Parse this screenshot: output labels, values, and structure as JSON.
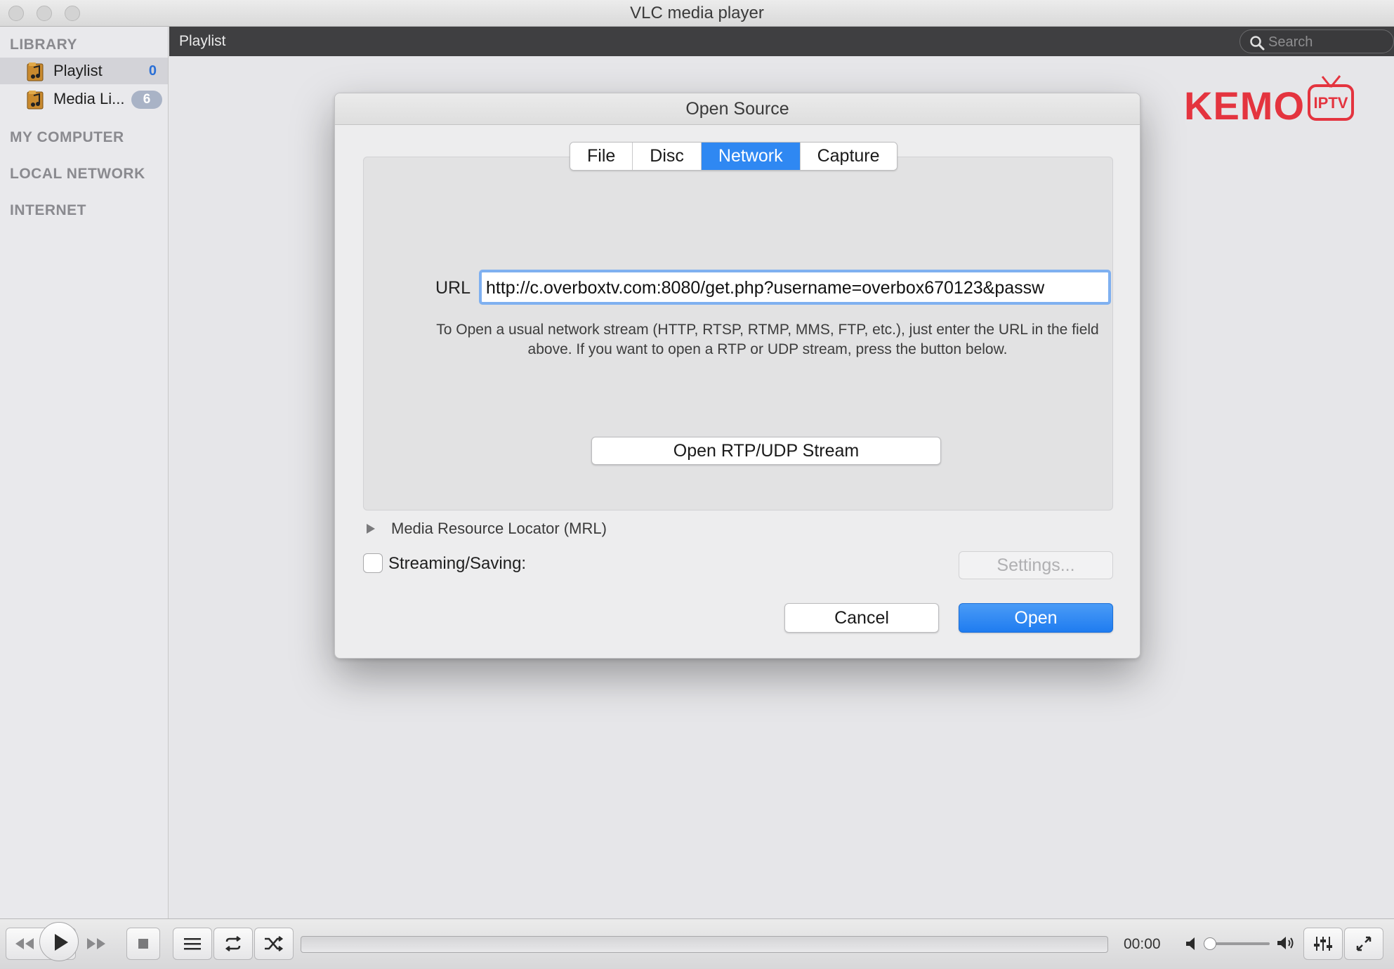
{
  "window": {
    "title": "VLC media player"
  },
  "sidebar": {
    "library_heading": "LIBRARY",
    "items": [
      {
        "label": "Playlist",
        "count": "0",
        "selected": true
      },
      {
        "label": "Media Li...",
        "count": "6",
        "selected": false
      }
    ],
    "sections": [
      "MY COMPUTER",
      "LOCAL NETWORK",
      "INTERNET"
    ]
  },
  "header": {
    "title": "Playlist",
    "search_placeholder": "Search"
  },
  "logo": {
    "text": "KEMO",
    "badge": "IPTV",
    "color": "#e4343f"
  },
  "dialog": {
    "title": "Open Source",
    "tabs": [
      {
        "label": "File",
        "active": false
      },
      {
        "label": "Disc",
        "active": false
      },
      {
        "label": "Network",
        "active": true
      },
      {
        "label": "Capture",
        "active": false
      }
    ],
    "url_label": "URL",
    "url_value": "http://c.overboxtv.com:8080/get.php?username=overbox670123&passw",
    "help_text": "To Open a usual network stream (HTTP, RTSP, RTMP, MMS, FTP, etc.), just enter the URL in the field above. If you want to open a RTP or UDP stream, press the button below.",
    "rtp_button": "Open RTP/UDP Stream",
    "mrl_label": "Media Resource Locator (MRL)",
    "streaming_label": "Streaming/Saving:",
    "streaming_checked": false,
    "settings_button": "Settings...",
    "cancel_button": "Cancel",
    "open_button": "Open",
    "accent_color": "#2f88f2"
  },
  "controls": {
    "time": "00:00",
    "icons": [
      "rewind-icon",
      "play-icon",
      "fast-forward-icon",
      "stop-icon",
      "playlist-icon",
      "repeat-icon",
      "shuffle-icon",
      "volume-min-icon",
      "volume-max-icon",
      "equalizer-icon",
      "fullscreen-icon"
    ]
  }
}
